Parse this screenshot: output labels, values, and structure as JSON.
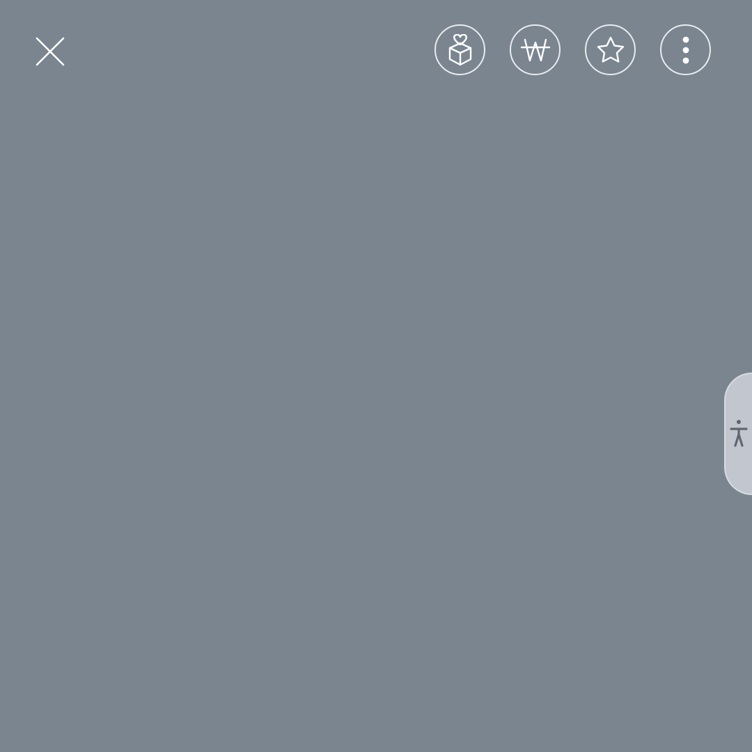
{
  "colors": {
    "background": "#7a8590",
    "icon_stroke": "#ffffff",
    "button_border": "#e9ecef",
    "accessibility_tab_bg": "#c2c7cf",
    "accessibility_icon": "#5f6670"
  },
  "header": {
    "close_icon": "close-icon",
    "actions": [
      {
        "name": "gift-icon"
      },
      {
        "name": "won-currency-icon"
      },
      {
        "name": "star-icon"
      },
      {
        "name": "more-vertical-icon"
      }
    ]
  },
  "accessibility": {
    "icon": "accessibility-person-icon"
  }
}
